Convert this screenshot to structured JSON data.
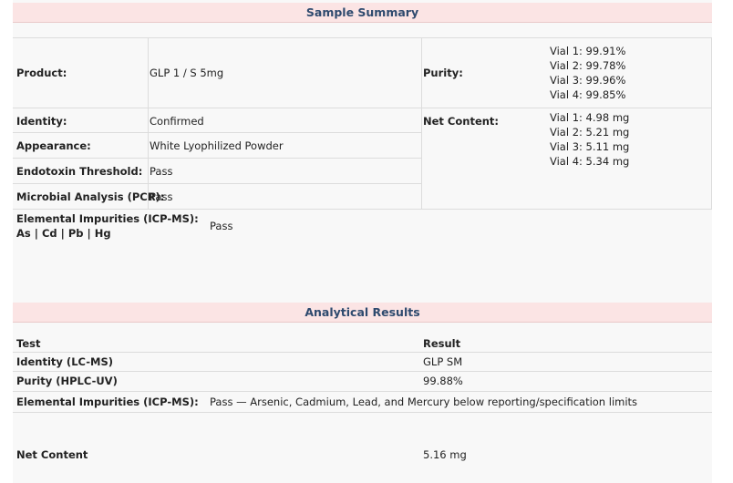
{
  "summary": {
    "heading": "Sample Summary",
    "product_label": "Product:",
    "product_value": "GLP 1 / S 5mg",
    "purity_label": "Purity:",
    "purity_values": [
      "Vial 1: 99.91%",
      "Vial 2: 99.78%",
      "Vial 3: 99.96%",
      "Vial 4: 99.85%"
    ],
    "identity_label": "Identity:",
    "identity_value": "Confirmed",
    "net_content_label": "Net Content:",
    "net_content_values": [
      "Vial 1: 4.98 mg",
      "Vial 2: 5.21 mg",
      "Vial 3: 5.11 mg",
      "Vial 4: 5.34 mg"
    ],
    "appearance_label": "Appearance:",
    "appearance_value": "White Lyophilized Powder",
    "endotoxin_label": "Endotoxin Threshold:",
    "endotoxin_value": "Pass",
    "microbial_label": "Microbial Analysis (PCR):",
    "microbial_value": "Pass",
    "elemental_label_line1": "Elemental Impurities (ICP-MS):",
    "elemental_label_line2": "As | Cd | Pb | Hg",
    "elemental_value": "Pass"
  },
  "results": {
    "heading": "Analytical Results",
    "col_test": "Test",
    "col_result": "Result",
    "rows": [
      {
        "test": "Identity (LC-MS)",
        "result": "GLP SM"
      },
      {
        "test": "Purity (HPLC-UV)",
        "result": "99.88%"
      },
      {
        "test": "Elemental Impurities (ICP-MS):",
        "result": "Pass — Arsenic, Cadmium, Lead, and Mercury below reporting/specification limits"
      },
      {
        "test": "Net Content",
        "result": "5.16 mg"
      }
    ]
  }
}
